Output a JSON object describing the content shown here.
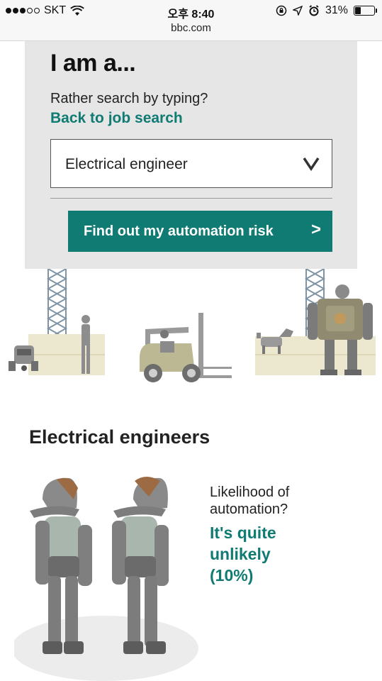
{
  "status_bar": {
    "carrier": "SKT",
    "time": "오후 8:40",
    "battery": "31%",
    "url": "bbc.com"
  },
  "search": {
    "heading": "I am a...",
    "prompt": "Rather search by typing?",
    "back_link": "Back to job search",
    "selected_job": "Electrical engineer",
    "cta_label": "Find out my automation risk",
    "cta_arrow": ">"
  },
  "result": {
    "title": "Electrical engineers",
    "likelihood_label_line1": "Likelihood of",
    "likelihood_label_line2": "automation?",
    "verdict_line1": "It's quite",
    "verdict_line2": "unlikely",
    "verdict_line3": "(10%)",
    "probability": 10
  },
  "colors": {
    "accent": "#0f7b73",
    "card_bg": "#e6e6e6"
  }
}
